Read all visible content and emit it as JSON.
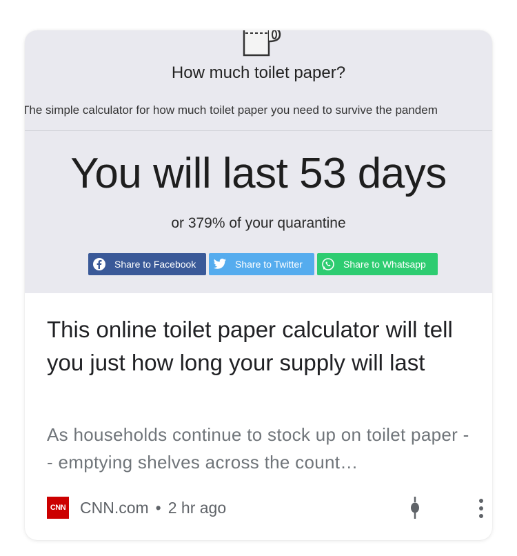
{
  "thumbnail": {
    "icon": "toilet-paper-icon",
    "title": "How much toilet paper?",
    "subtitle": "The simple calculator for how much toilet paper you need to survive the pandem",
    "result_prefix": "You will last ",
    "result_number": "53",
    "result_suffix": " days",
    "percent_prefix": "or ",
    "percent_value": "379%",
    "percent_suffix": " of your quarantine",
    "share_buttons": [
      {
        "label": "Share to Facebook",
        "icon": "facebook-icon",
        "color": "#3a5998"
      },
      {
        "label": "Share to Twitter",
        "icon": "twitter-icon",
        "color": "#55acee"
      },
      {
        "label": "Share to Whatsapp",
        "icon": "whatsapp-icon",
        "color": "#2ecc71"
      }
    ]
  },
  "article": {
    "headline": "This online toilet paper calculator will tell you just how long your supply will last",
    "snippet": "As households continue to stock up on toilet paper -- emptying shelves across the count…"
  },
  "footer": {
    "source_logo_text": "CNN",
    "source_name": "CNN.com",
    "separator": "•",
    "time_ago": "2 hr ago",
    "pin_icon": "pin-icon",
    "more_icon": "more-vert-icon"
  }
}
